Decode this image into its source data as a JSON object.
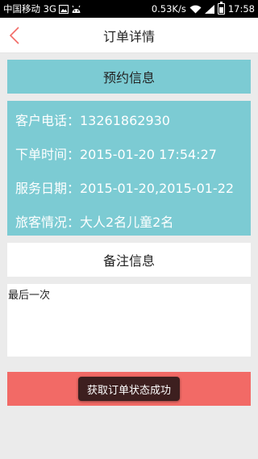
{
  "status_bar": {
    "carrier": "中国移动 3G",
    "speed": "0.53K/s",
    "time": "17:58"
  },
  "header": {
    "title": "订单详情"
  },
  "booking": {
    "section_title": "预约信息",
    "rows": [
      "客户电话：13261862930",
      "下单时间：2015-01-20 17:54:27",
      "服务日期：2015-01-20,2015-01-22",
      "旅客情况：大人2名儿童2名"
    ]
  },
  "remark": {
    "section_title": "备注信息",
    "text": "最后一次"
  },
  "toast": {
    "message": "获取订单状态成功"
  },
  "colors": {
    "accent_teal": "#7ccbd3",
    "bottom_red": "#f26a66",
    "back_arrow": "#f26a66"
  }
}
